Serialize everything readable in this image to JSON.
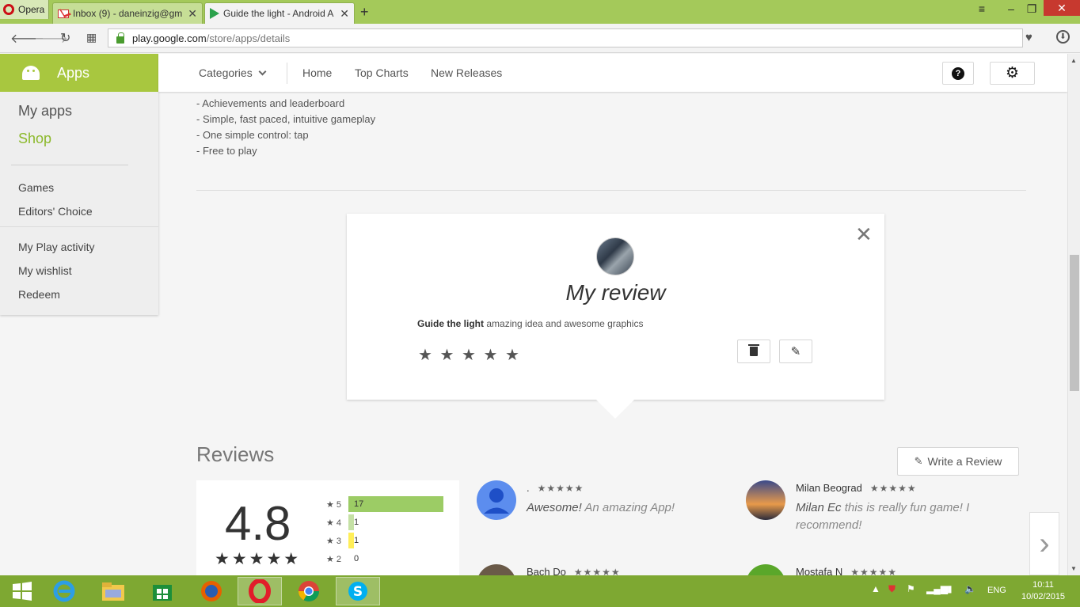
{
  "browser": {
    "menu_label": "Opera",
    "tabs": [
      {
        "title": "Inbox (9) - daneinzig@gm",
        "close": "✕"
      },
      {
        "title": "Guide the light - Android A",
        "close": "✕"
      }
    ],
    "new_tab": "+",
    "address": {
      "host": "play.google.com",
      "path": "/store/apps/details"
    }
  },
  "sidebar": {
    "header": "Apps",
    "primary": [
      {
        "label": "My apps"
      },
      {
        "label": "Shop"
      }
    ],
    "secondary": [
      {
        "label": "Games"
      },
      {
        "label": "Editors' Choice"
      }
    ],
    "tertiary": [
      {
        "label": "My Play activity"
      },
      {
        "label": "My wishlist"
      },
      {
        "label": "Redeem"
      }
    ]
  },
  "topnav": {
    "categories": "Categories",
    "items": [
      {
        "label": "Home"
      },
      {
        "label": "Top Charts"
      },
      {
        "label": "New Releases"
      }
    ]
  },
  "description_lines": [
    "- Achievements and leaderboard",
    "- Simple, fast paced, intuitive gameplay",
    "- One simple control: tap",
    "- Free to play"
  ],
  "my_review": {
    "title": "My review",
    "review_title": "Guide the light",
    "review_text": "amazing idea and awesome graphics",
    "stars": "★ ★ ★ ★ ★"
  },
  "reviews": {
    "heading": "Reviews",
    "write_button": "Write a Review",
    "average": "4.8",
    "average_stars": "★★★★★",
    "histogram": [
      {
        "label": "★ 5",
        "count": "17",
        "value": 17,
        "color": "#9ccc65"
      },
      {
        "label": "★ 4",
        "count": "1",
        "value": 1,
        "color": "#c5e1a5"
      },
      {
        "label": "★ 3",
        "count": "1",
        "value": 1,
        "color": "#ffee58"
      },
      {
        "label": "★ 2",
        "count": "0",
        "value": 0,
        "color": "#ffcc80"
      }
    ],
    "items": [
      {
        "author": ".",
        "stars": "★★★★★",
        "title": "Awesome!",
        "body": "An amazing App!"
      },
      {
        "author": "Milan Beograd",
        "stars": "★★★★★",
        "title": "Milan Ec",
        "body": "this is really fun game! I recommend!"
      },
      {
        "author": "Bach Do",
        "stars": "★★★★★",
        "title": "",
        "body": ""
      },
      {
        "author": "Mostafa N",
        "stars": "★★★★★",
        "title": "",
        "body": ""
      }
    ],
    "next_arrow": "›"
  },
  "taskbar": {
    "language": "ENG",
    "time": "10:11",
    "date": "10/02/2015"
  },
  "colors": {
    "play_green": "#a8c73f",
    "taskbar": "#7ea832",
    "tabbar": "#a4c95a"
  }
}
